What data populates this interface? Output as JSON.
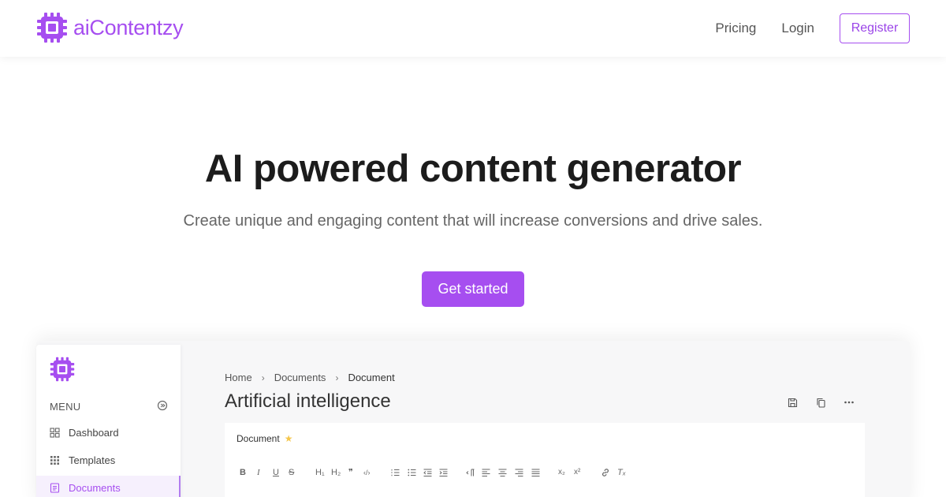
{
  "header": {
    "brand": "aiContentzy",
    "nav": {
      "pricing": "Pricing",
      "login": "Login",
      "register": "Register"
    }
  },
  "colors": {
    "accent": "#a64ef0",
    "star": "#f5c64a"
  },
  "hero": {
    "title": "AI powered content generator",
    "subtitle": "Create unique and engaging content that will increase conversions and drive sales.",
    "cta": "Get started"
  },
  "preview": {
    "menu_label": "MENU",
    "sidebar": [
      {
        "label": "Dashboard",
        "icon": "dashboard-icon"
      },
      {
        "label": "Templates",
        "icon": "grid-icon"
      },
      {
        "label": "Documents",
        "icon": "document-icon",
        "active": true
      }
    ],
    "breadcrumb": [
      "Home",
      "Documents",
      "Document"
    ],
    "doc_title": "Artificial intelligence",
    "editor_label": "Document",
    "toolbar": {
      "bold": "B",
      "italic": "I",
      "underline": "U",
      "strike": "S",
      "h1": "H₁",
      "h2": "H₂",
      "quote": "❞",
      "code": "‹/›",
      "subscript": "x₂",
      "superscript": "x²",
      "clear": "Tₓ"
    }
  }
}
